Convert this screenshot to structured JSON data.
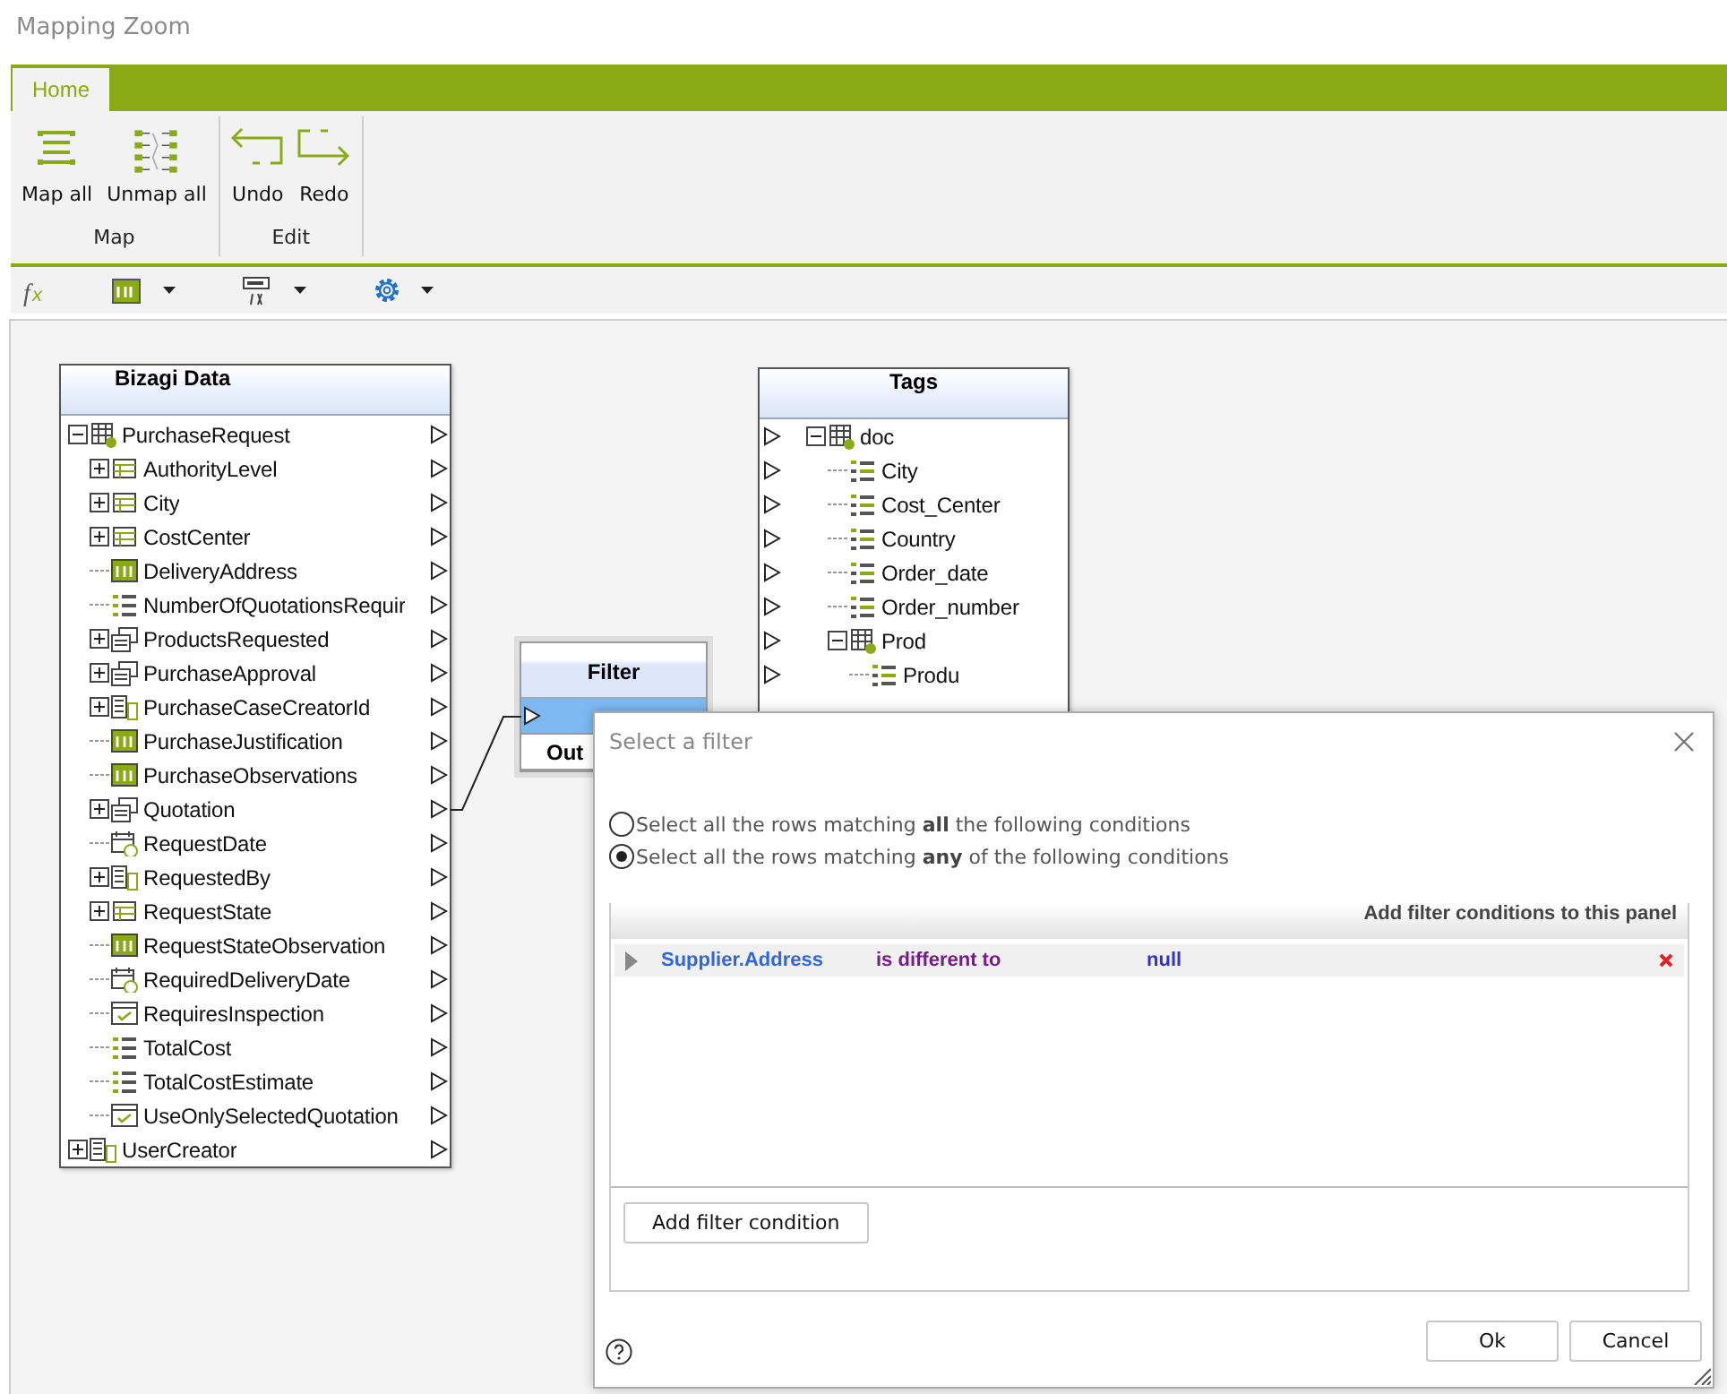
{
  "window": {
    "title": "Mapping Zoom"
  },
  "ribbon": {
    "tabs": [
      {
        "label": "Home",
        "selected": true
      }
    ],
    "groups": [
      {
        "label": "Map",
        "buttons": [
          {
            "label": "Map all",
            "kind": "map"
          },
          {
            "label": "Unmap all",
            "kind": "unmap"
          }
        ]
      },
      {
        "label": "Edit",
        "buttons": [
          {
            "label": "Undo",
            "kind": "undo"
          },
          {
            "label": "Redo",
            "kind": "redo"
          }
        ]
      }
    ]
  },
  "toolbar": {
    "items": [
      {
        "kind": "fx",
        "dropdown": false
      },
      {
        "kind": "text",
        "dropdown": true
      },
      {
        "kind": "formula",
        "dropdown": true
      },
      {
        "kind": "gear",
        "dropdown": true
      }
    ]
  },
  "source_table": {
    "title": "Bizagi Data",
    "items": [
      {
        "name": "PurchaseRequest",
        "kind": "entity",
        "expandable": true,
        "expanded": true,
        "children": [
          {
            "name": "AuthorityLevel",
            "kind": "table",
            "expandable": true,
            "expanded": false
          },
          {
            "name": "City",
            "kind": "table",
            "expandable": true,
            "expanded": false
          },
          {
            "name": "CostCenter",
            "kind": "table",
            "expandable": true,
            "expanded": false
          },
          {
            "name": "DeliveryAddress",
            "kind": "text",
            "expandable": false,
            "expanded": false
          },
          {
            "name": "NumberOfQuotationsRequir",
            "kind": "number",
            "expandable": false,
            "expanded": false
          },
          {
            "name": "ProductsRequested",
            "kind": "collection",
            "expandable": true,
            "expanded": false
          },
          {
            "name": "PurchaseApproval",
            "kind": "collection",
            "expandable": true,
            "expanded": false
          },
          {
            "name": "PurchaseCaseCreatorId",
            "kind": "user",
            "expandable": true,
            "expanded": false
          },
          {
            "name": "PurchaseJustification",
            "kind": "text",
            "expandable": false,
            "expanded": false
          },
          {
            "name": "PurchaseObservations",
            "kind": "text",
            "expandable": false,
            "expanded": false
          },
          {
            "name": "Quotation",
            "kind": "collection",
            "expandable": true,
            "expanded": false
          },
          {
            "name": "RequestDate",
            "kind": "date",
            "expandable": false,
            "expanded": false
          },
          {
            "name": "RequestedBy",
            "kind": "user",
            "expandable": true,
            "expanded": false
          },
          {
            "name": "RequestState",
            "kind": "table",
            "expandable": true,
            "expanded": false
          },
          {
            "name": "RequestStateObservation",
            "kind": "text",
            "expandable": false,
            "expanded": false
          },
          {
            "name": "RequiredDeliveryDate",
            "kind": "date",
            "expandable": false,
            "expanded": false
          },
          {
            "name": "RequiresInspection",
            "kind": "check",
            "expandable": false,
            "expanded": false
          },
          {
            "name": "TotalCost",
            "kind": "number",
            "expandable": false,
            "expanded": false
          },
          {
            "name": "TotalCostEstimate",
            "kind": "number",
            "expandable": false,
            "expanded": false
          },
          {
            "name": "UseOnlySelectedQuotation",
            "kind": "check",
            "expandable": false,
            "expanded": false
          }
        ]
      },
      {
        "name": "UserCreator",
        "kind": "user",
        "expandable": true,
        "expanded": false
      }
    ]
  },
  "filter_node": {
    "title": "Filter",
    "ports": [
      {
        "selected": true
      },
      {
        "label": "Out",
        "selected": false
      }
    ]
  },
  "target_table": {
    "title": "Tags",
    "items": [
      {
        "name": "doc",
        "kind": "entity",
        "expandable": true,
        "expanded": true,
        "children": [
          {
            "name": "City",
            "kind": "tag",
            "expandable": false,
            "expanded": false
          },
          {
            "name": "Cost_Center",
            "kind": "tag",
            "expandable": false,
            "expanded": false
          },
          {
            "name": "Country",
            "kind": "tag",
            "expandable": false,
            "expanded": false
          },
          {
            "name": "Order_date",
            "kind": "tag",
            "expandable": false,
            "expanded": false
          },
          {
            "name": "Order_number",
            "kind": "tag",
            "expandable": false,
            "expanded": false
          },
          {
            "name": "Prod",
            "kind": "entity",
            "expandable": true,
            "expanded": true,
            "children": [
              {
                "name": "Produ",
                "kind": "tag",
                "expandable": false,
                "expanded": false
              }
            ]
          }
        ]
      }
    ]
  },
  "dialog": {
    "title": "Select a filter",
    "options": [
      {
        "label": "Select all the rows matching **all** the following conditions",
        "selected": false
      },
      {
        "label": "Select all the rows matching **any** of the following conditions",
        "selected": true
      }
    ],
    "panel_header": "Add filter conditions to this panel",
    "conditions": [
      {
        "field": "Supplier.Address",
        "operator": "is different to",
        "value": "null"
      }
    ],
    "add_button": "Add filter condition",
    "buttons": [
      "Ok",
      "Cancel"
    ]
  }
}
